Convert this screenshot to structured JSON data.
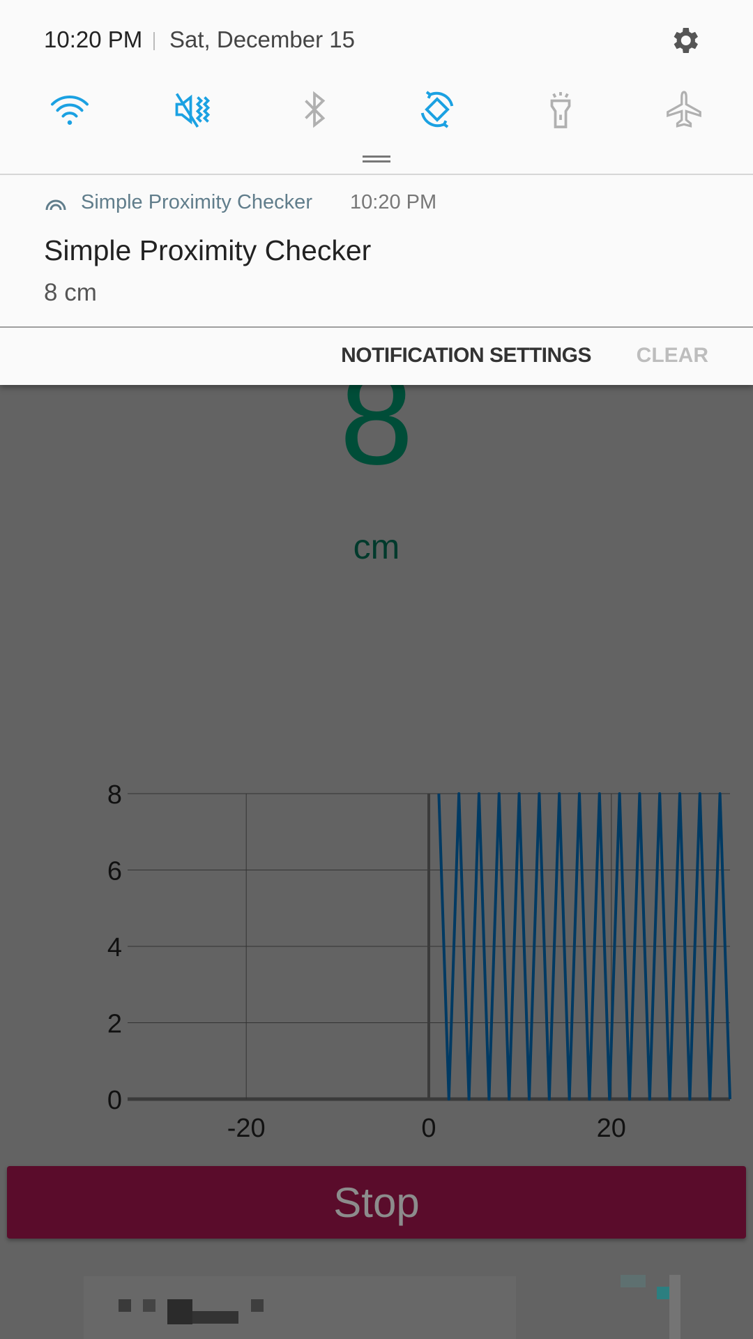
{
  "status": {
    "time": "10:20 PM",
    "date": "Sat, December 15"
  },
  "quick_settings": [
    {
      "icon": "wifi-icon",
      "active": true
    },
    {
      "icon": "sound-mute-vibrate-icon",
      "active": true
    },
    {
      "icon": "bluetooth-icon",
      "active": false
    },
    {
      "icon": "auto-rotate-icon",
      "active": true
    },
    {
      "icon": "flashlight-icon",
      "active": false
    },
    {
      "icon": "airplane-mode-icon",
      "active": false
    }
  ],
  "notification": {
    "app_name": "Simple Proximity Checker",
    "time": "10:20 PM",
    "title": "Simple Proximity Checker",
    "body": "8 cm"
  },
  "actions": {
    "settings": "NOTIFICATION SETTINGS",
    "clear": "CLEAR"
  },
  "app": {
    "reading": "8",
    "unit": "cm",
    "stop_label": "Stop"
  },
  "colors": {
    "active_icon": "#1ba1e2",
    "inactive_icon": "#b0b0b0",
    "reading": "#004d38",
    "line": "#003a63",
    "stop_button": "#5a0c2b"
  },
  "chart_data": {
    "type": "line",
    "xlim": [
      -33,
      33
    ],
    "ylim": [
      0,
      8
    ],
    "yticks": [
      "0",
      "2",
      "4",
      "6",
      "8"
    ],
    "xticks": [
      "-20",
      "0",
      "20"
    ],
    "grid": true,
    "x": [
      1.1,
      2.2,
      3.3,
      4.4,
      5.5,
      6.6,
      7.7,
      8.8,
      9.9,
      11,
      12.1,
      13.2,
      14.3,
      15.4,
      16.5,
      17.6,
      18.7,
      19.8,
      20.9,
      22,
      23.1,
      24.2,
      25.3,
      26.4,
      27.5,
      28.6,
      29.7,
      30.8,
      31.9,
      33
    ],
    "y": [
      8,
      0,
      8,
      0,
      8,
      0,
      8,
      0,
      8,
      0,
      8,
      0,
      8,
      0,
      8,
      0,
      8,
      0,
      8,
      0,
      8,
      0,
      8,
      0,
      8,
      0,
      8,
      0,
      8,
      0
    ]
  }
}
